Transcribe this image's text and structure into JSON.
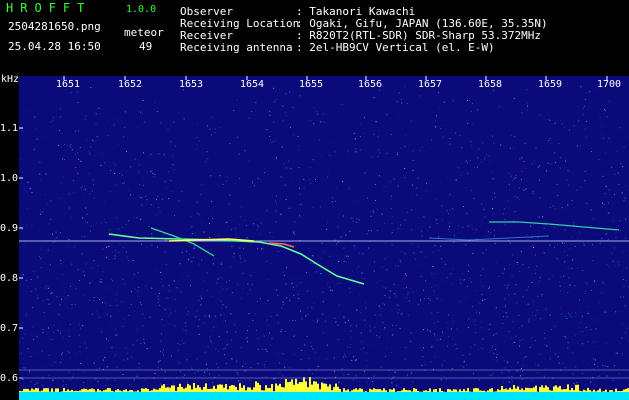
{
  "header": {
    "app_title": "HROFFT",
    "version": "1.0.0",
    "filename": "2504281650.png",
    "datetime": "25.04.28 16:50",
    "meteor_label": "meteor",
    "meteor_count": "49",
    "info": [
      {
        "label": "Observer",
        "value": ": Takanori Kawachi"
      },
      {
        "label": "Receiving Location",
        "value": ": Ogaki, Gifu, JAPAN (136.60E, 35.35N)"
      },
      {
        "label": "Receiver",
        "value": ": R820T2(RTL-SDR) SDR-Sharp 53.372MHz"
      },
      {
        "label": "Receiving antenna",
        "value": ": 2el-HB9CV Vertical (el. E-W)"
      }
    ]
  },
  "axes": {
    "unit": "kHz",
    "y_ticks": [
      "1.1",
      "1.0",
      "0.9",
      "0.8",
      "0.7",
      "0.6"
    ],
    "x_ticks": [
      "1651",
      "1652",
      "1653",
      "1654",
      "1655",
      "1656",
      "1657",
      "1658",
      "1659",
      "1700"
    ]
  },
  "colors": {
    "header_text": "#ffffff",
    "title_green": "#33ff33",
    "background_blue": "#0a0a7a",
    "carrier_line": "#c8c8ff",
    "meteor_trace": "#66ff99",
    "bottom_band": "#00e5ff",
    "bottom_peaks": "#ffff33"
  }
}
